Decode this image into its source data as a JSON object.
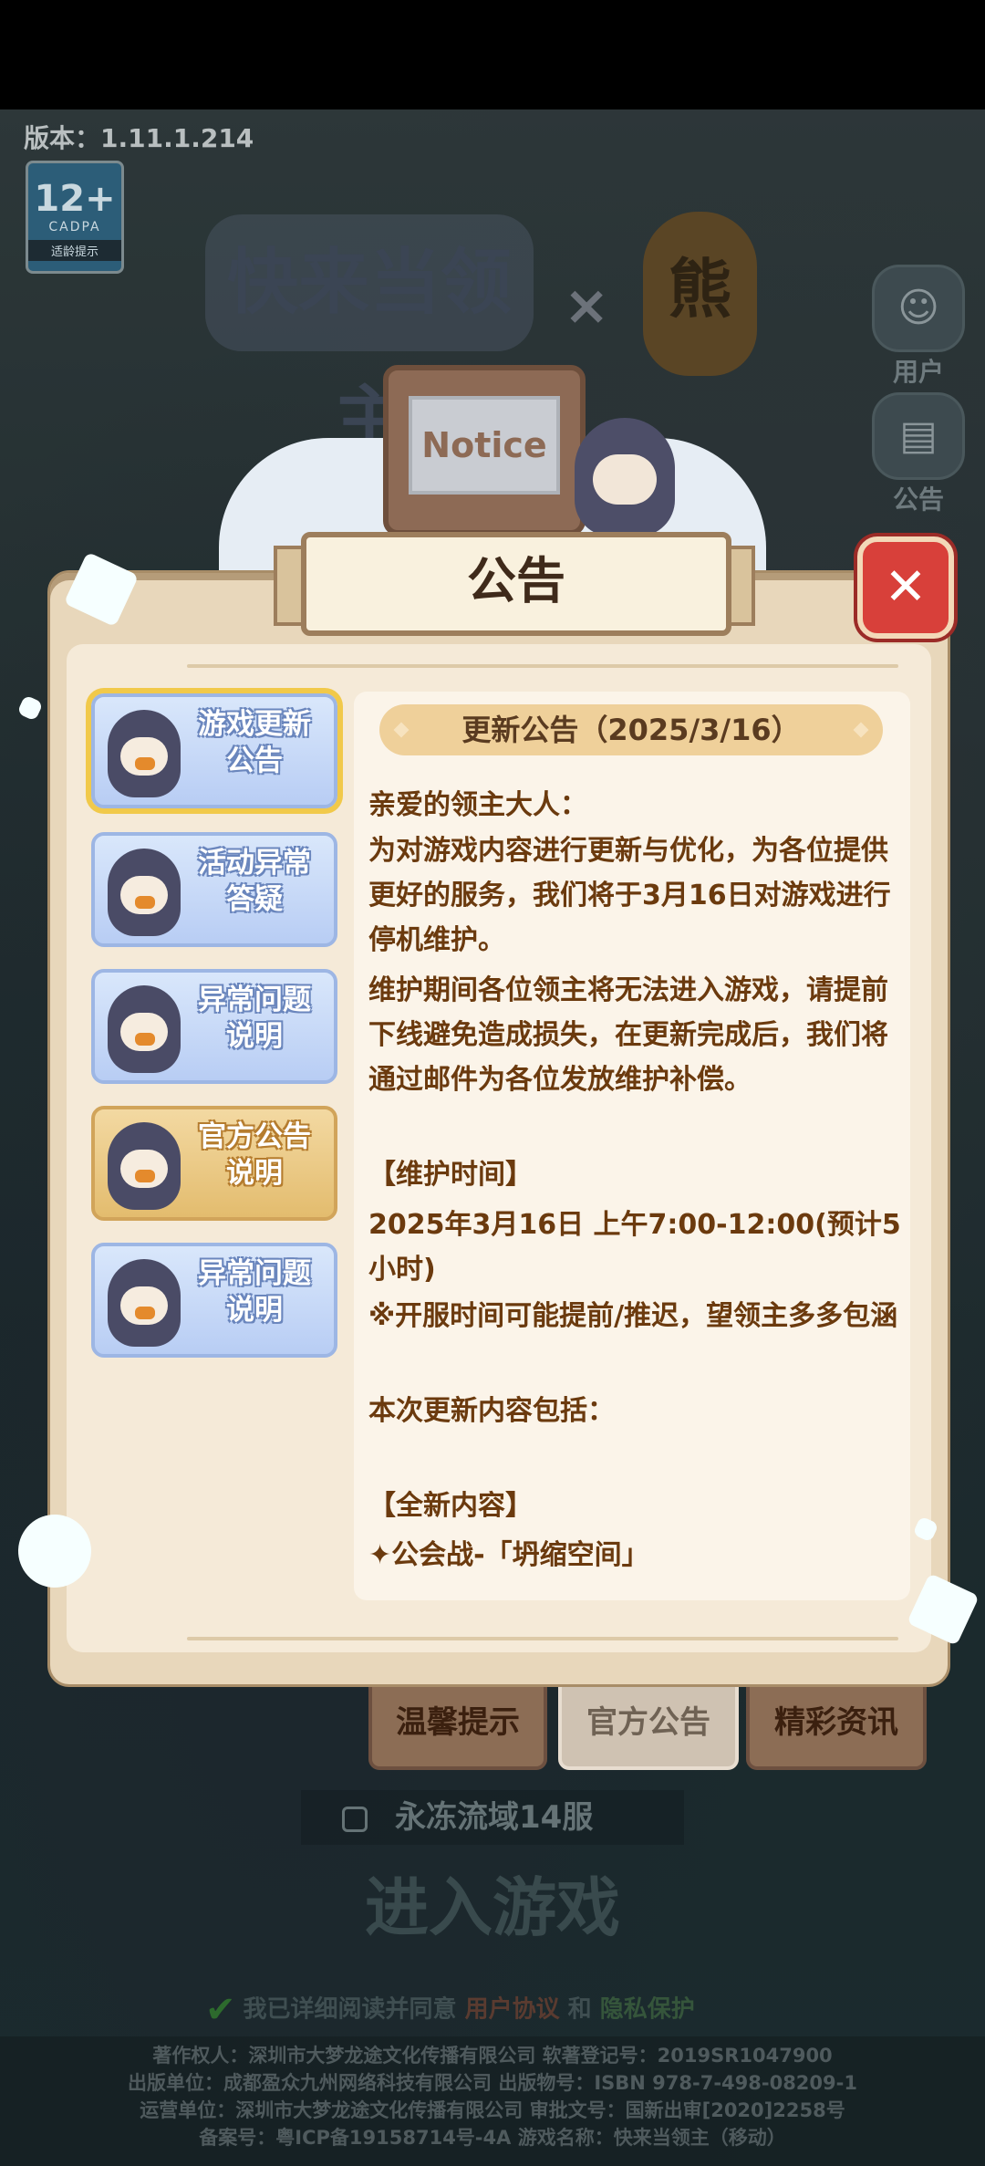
{
  "version_text": "版本：1.11.1.214",
  "age_rating": {
    "number": "12+",
    "org": "CADPA",
    "label": "适龄提示"
  },
  "game_logo_text": "快来当领主",
  "collab_x": "×",
  "partner_logo_text": "熊",
  "side_menu": [
    {
      "label": "用户",
      "icon": "user-icon"
    },
    {
      "label": "公告",
      "icon": "notice-icon"
    }
  ],
  "board_text": "Notice",
  "modal": {
    "title": "公告",
    "close_label": "✕",
    "left_tabs": [
      {
        "label": "游戏更新公告",
        "line1": "游戏更新",
        "line2": "公告",
        "style": "blue",
        "selected": true
      },
      {
        "label": "活动异常答疑",
        "line1": "活动异常",
        "line2": "答疑",
        "style": "blue",
        "selected": false
      },
      {
        "label": "异常问题说明",
        "line1": "异常问题",
        "line2": "说明",
        "style": "blue",
        "selected": false
      },
      {
        "label": "官方公告说明",
        "line1": "官方公告",
        "line2": "说明",
        "style": "gold",
        "selected": false
      },
      {
        "label": "异常问题说明",
        "line1": "异常问题",
        "line2": "说明",
        "style": "blue",
        "selected": false
      }
    ],
    "content_title": "更新公告（2025/3/16）",
    "content_lines": [
      "亲爱的领主大人：",
      "为对游戏内容进行更新与优化，为各位提供更好的服务，我们将于3月16日对游戏进行停机维护。",
      "维护期间各位领主将无法进入游戏，请提前下线避免造成损失，在更新完成后，我们将通过邮件为各位发放维护补偿。",
      "",
      "【维护时间】",
      "2025年3月16日 上午7:00-12:00(预计5小时)",
      "※开服时间可能提前/推迟，望领主多多包涵",
      "",
      "本次更新内容包括：",
      "",
      "【全新内容】",
      "✦公会战-「坍缩空间」"
    ]
  },
  "bottom_tabs": [
    {
      "label": "温馨提示",
      "selected": false
    },
    {
      "label": "官方公告",
      "selected": true
    },
    {
      "label": "精彩资讯",
      "selected": false
    }
  ],
  "server_name": "永冻流域14服",
  "enter_game": "进入游戏",
  "agreement": {
    "prefix": "我已详细阅读并同意",
    "link1": "用户协议",
    "and": "和",
    "link2": "隐私保护"
  },
  "footer_lines": [
    "著作权人：深圳市大梦龙途文化传播有限公司 软著登记号：2019SR1047900",
    "出版单位：成都盈众九州网络科技有限公司 出版物号：ISBN 978-7-498-08209-1",
    "运营单位：深圳市大梦龙途文化传播有限公司 审批文号：国新出审[2020]2258号",
    "备案号：粤ICP备19158714号-4A 游戏名称：快来当领主（移动）"
  ]
}
